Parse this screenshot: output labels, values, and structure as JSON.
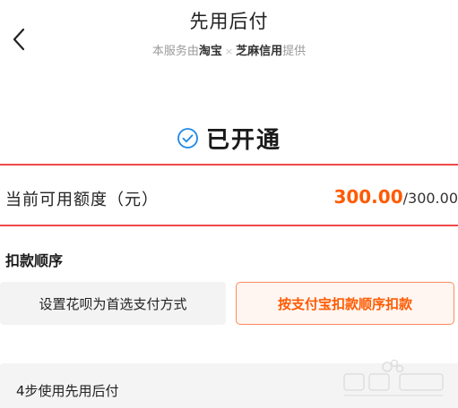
{
  "header": {
    "back_icon": "chevron-left-icon",
    "title": "先用后付",
    "subtitle": {
      "prefix": "本服务由",
      "partner1": "淘宝",
      "separator": "×",
      "partner2": "芝麻信用",
      "suffix": "提供"
    }
  },
  "status": {
    "icon": "check-circle-icon",
    "text": "已开通",
    "icon_color": "#1e88e5"
  },
  "quota": {
    "label": "当前可用额度（元）",
    "current": "300.00",
    "total": "/300.00",
    "accent_color": "#ff5a00",
    "border_color": "#f0484b"
  },
  "deduction": {
    "title": "扣款顺序",
    "options": [
      {
        "label": "设置花呗为首选支付方式",
        "selected": false
      },
      {
        "label": "按支付宝扣款顺序扣款",
        "selected": true
      }
    ]
  },
  "steps": {
    "label": "4步使用先用后付"
  }
}
